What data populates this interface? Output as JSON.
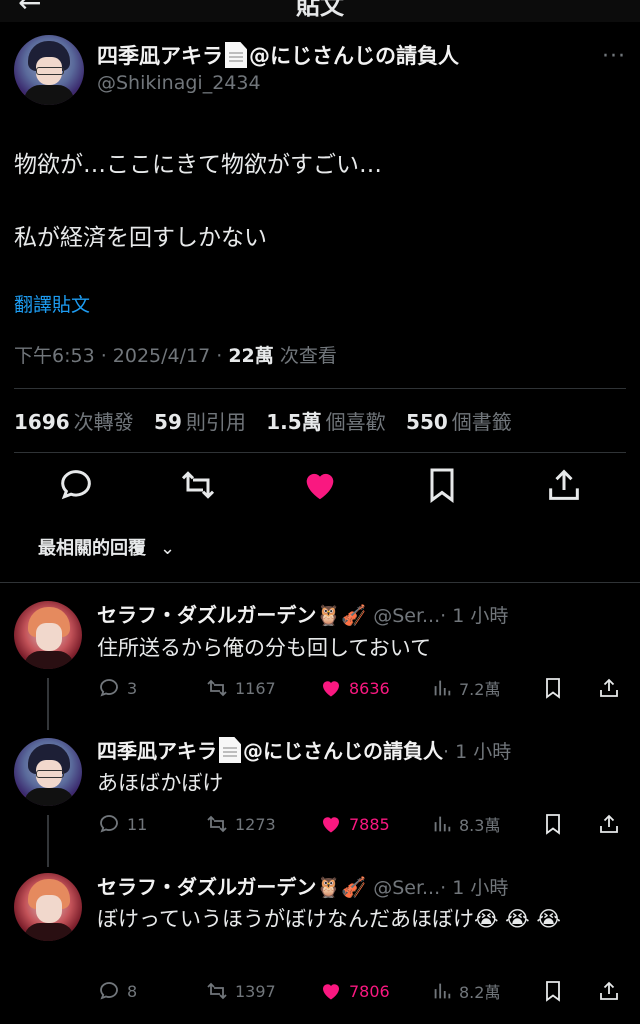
{
  "header": {
    "back_icon": "arrow-left-icon",
    "title": "貼文"
  },
  "main_tweet": {
    "display_name": "四季凪アキラ",
    "display_name_suffix": "@にじさんじの請負人",
    "handle": "@Shikinagi_2434",
    "more": "···",
    "text_line1": "物欲が…ここにきて物欲がすごい…",
    "text_line2": "私が経済を回すしかない",
    "translate_label": "翻譯貼文",
    "meta_time": "下午6:53 · 2025/4/17 · ",
    "meta_views": "22萬",
    "meta_views_suffix": " 次查看",
    "stats": {
      "retweets": "1696",
      "retweets_label": "次轉發",
      "quotes": "59",
      "quotes_label": "則引用",
      "likes": "1.5萬",
      "likes_label": "個喜歡",
      "bookmarks": "550",
      "bookmarks_label": "個書籤"
    },
    "actions": [
      "reply-icon",
      "retweet-icon",
      "heart-filled-icon",
      "bookmark-icon",
      "share-icon"
    ],
    "like_color": "#f91880"
  },
  "sort_label": "最相關的回覆",
  "replies": [
    {
      "name": "セラフ・ダズルガーデン",
      "name_emojis": "🦉🎻",
      "handle": "@Ser...",
      "time": "· 1 小時",
      "text": "住所送るから俺の分も回しておいて",
      "reply_count": "3",
      "retweet_count": "1167",
      "like_count": "8636",
      "view_count": "7.2萬"
    },
    {
      "name": "四季凪アキラ",
      "name_suffix": "@にじさんじの請負人",
      "time": "· 1 小時",
      "text": "あほばかぼけ",
      "reply_count": "11",
      "retweet_count": "1273",
      "like_count": "7885",
      "view_count": "8.3萬"
    },
    {
      "name": "セラフ・ダズルガーデン",
      "name_emojis": "🦉🎻",
      "handle": "@Ser...",
      "time": "· 1 小時",
      "text": "ぼけっていうほうがぼけなんだあほぼけ😭 😭 😭",
      "reply_count": "8",
      "retweet_count": "1397",
      "like_count": "7806",
      "view_count": "8.2萬"
    }
  ]
}
